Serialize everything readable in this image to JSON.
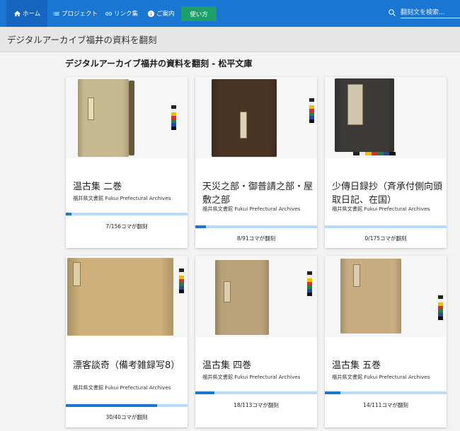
{
  "nav": {
    "home": "ホーム",
    "projects": "プロジェクト",
    "links": "リンク集",
    "info": "ご案内",
    "guide_button": "使い方",
    "search_placeholder": "翻刻文を検索..."
  },
  "page_header": "デジタルアーカイブ福井の資料を翻刻",
  "subtitle": "デジタルアーカイブ福井の資料を翻刻 - 松平文庫",
  "colors": {
    "nav": "#1976d2",
    "guide_button": "#1e9e68",
    "progress": "#1976d2",
    "progress_track": "#b9dbf5"
  },
  "cards": [
    {
      "title": "温古集 二巻",
      "org": "福井県文書館 Fukui Prefectural Archives",
      "progress_text": "7/156コマが翻刻",
      "progress": 0.045,
      "image": "book-photo"
    },
    {
      "title": "天災之部・御普請之部・屋敷之部",
      "org": "福井県文書館 Fukui Prefectural Archives",
      "progress_text": "8/91コマが翻刻",
      "progress": 0.088,
      "image": "book-photo"
    },
    {
      "title": "少傳日録抄（斉承付側向頭取日記、在国）",
      "org": "福井県文書館 Fukui Prefectural Archives",
      "progress_text": "0/175コマが翻刻",
      "progress": 0.0,
      "image": "book-photo"
    },
    {
      "title": "漂客談奇（備考雑録写8）",
      "org": "福井県文書館 Fukui Prefectural Archives",
      "progress_text": "30/40コマが翻刻",
      "progress": 0.75,
      "image": "book-photo"
    },
    {
      "title": "温古集 四巻",
      "org": "福井県文書館 Fukui Prefectural Archives",
      "progress_text": "18/113コマが翻刻",
      "progress": 0.159,
      "image": "book-photo"
    },
    {
      "title": "温古集 五巻",
      "org": "福井県文書館 Fukui Prefectural Archives",
      "progress_text": "14/111コマが翻刻",
      "progress": 0.126,
      "image": "book-photo"
    }
  ]
}
